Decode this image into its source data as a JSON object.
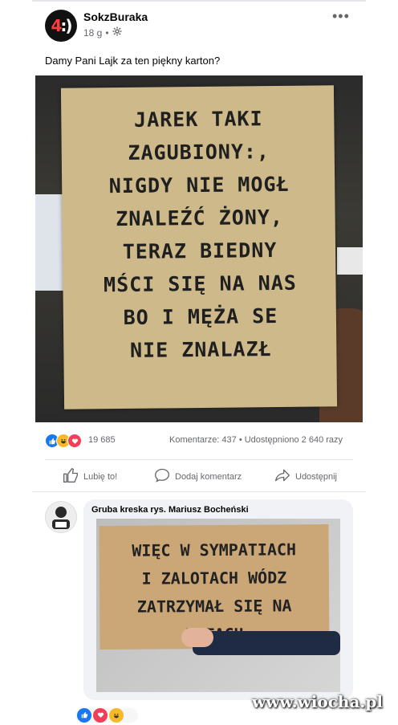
{
  "post": {
    "author": "SokzBuraka",
    "time": "18 g",
    "separator": "•",
    "privacy_icon": "gear-icon",
    "more": "•••",
    "caption": "Damy Pani Lajk za ten piękny karton?",
    "sign_lines": [
      "JAREK TAKI",
      "ZAGUBIONY:,",
      "NIGDY NIE MOGŁ",
      "ZNALEŹĆ ŻONY,",
      "TERAZ BIEDNY",
      "MŚCI SIĘ NA NAS",
      "BO I MĘŻA SE",
      "NIE ZNALAZŁ"
    ]
  },
  "stats": {
    "reaction_icons": [
      "like-icon",
      "haha-icon",
      "love-icon"
    ],
    "reaction_count": "19 685",
    "comments_shares": "Komentarze: 437 • Udostępniono 2 640 razy"
  },
  "actions": {
    "like": "Lubię to!",
    "comment": "Dodaj komentarz",
    "share": "Udostępnij"
  },
  "comment": {
    "author": "Gruba kreska rys. Mariusz Bocheński",
    "sign_lines": [
      "WIĘC W SYMPATIACH",
      "I ZALOTACH WÓDZ",
      "ZATRZYMAŁ SIĘ NA",
      "KOTACH"
    ]
  },
  "watermark": "www.wiocha.pl",
  "colors": {
    "accent": "#1877f2",
    "meta_text": "#65676b",
    "cardboard": "#cdb98a"
  }
}
